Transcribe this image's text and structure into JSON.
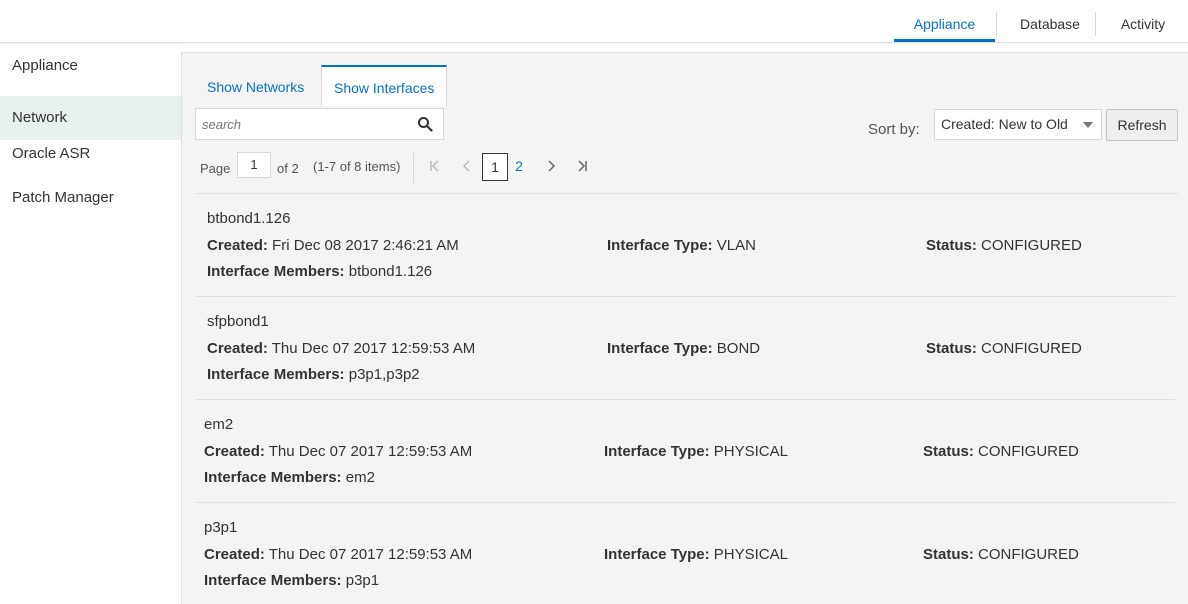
{
  "topnav": {
    "tabs": [
      {
        "label": "Appliance",
        "active": true
      },
      {
        "label": "Database",
        "active": false
      },
      {
        "label": "Activity",
        "active": false
      }
    ]
  },
  "sidebar": {
    "items": [
      {
        "label": "Appliance",
        "active": false
      },
      {
        "label": "Network",
        "active": true
      },
      {
        "label": "Oracle ASR",
        "active": false
      },
      {
        "label": "Patch Manager",
        "active": false
      }
    ]
  },
  "subtabs": [
    {
      "label": "Show Networks",
      "active": false
    },
    {
      "label": "Show Interfaces",
      "active": true
    }
  ],
  "search": {
    "placeholder": "search",
    "value": "",
    "icon": "search-icon"
  },
  "sort": {
    "label": "Sort by:",
    "selected": "Created: New to Old",
    "refresh_label": "Refresh"
  },
  "pager": {
    "page_label": "Page",
    "current_page": "1",
    "of_label": "of 2",
    "items_info": "(1-7 of 8 items)",
    "pages": [
      "1",
      "2"
    ]
  },
  "labels": {
    "created": "Created:",
    "interface_type": "Interface Type:",
    "status": "Status:",
    "members": "Interface Members:"
  },
  "interfaces": [
    {
      "name": "btbond1.126",
      "created": "Fri Dec 08 2017 2:46:21 AM",
      "type": "VLAN",
      "status": "CONFIGURED",
      "members": "btbond1.126"
    },
    {
      "name": "sfpbond1",
      "created": "Thu Dec 07 2017 12:59:53 AM",
      "type": "BOND",
      "status": "CONFIGURED",
      "members": "p3p1,p3p2"
    },
    {
      "name": "em2",
      "created": "Thu Dec 07 2017 12:59:53 AM",
      "type": "PHYSICAL",
      "status": "CONFIGURED",
      "members": "em2"
    },
    {
      "name": "p3p1",
      "created": "Thu Dec 07 2017 12:59:53 AM",
      "type": "PHYSICAL",
      "status": "CONFIGURED",
      "members": "p3p1"
    }
  ],
  "colors": {
    "accent": "#0572ce",
    "panel_bg": "#f4f4f4",
    "sidebar_active": "#e9f0f0"
  }
}
